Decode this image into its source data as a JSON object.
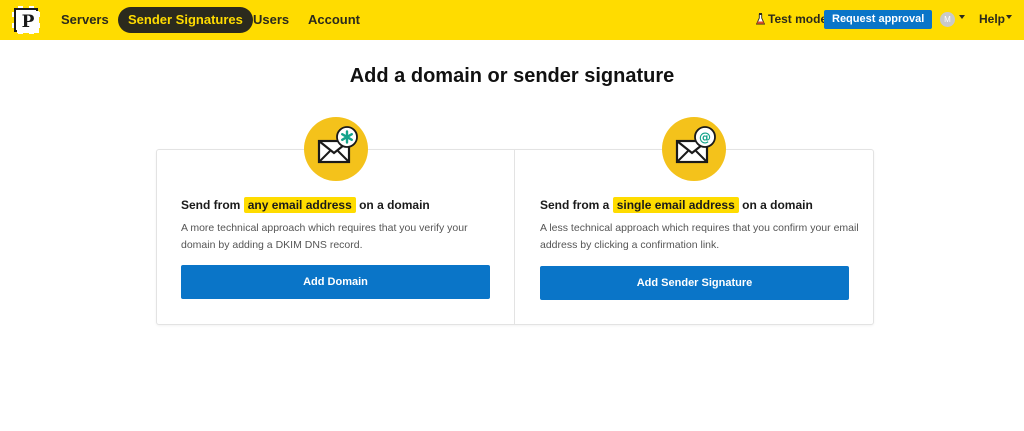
{
  "topbar": {
    "logo_letter": "P",
    "nav": {
      "servers": "Servers",
      "sender_signatures": "Sender Signatures",
      "users": "Users",
      "account": "Account"
    },
    "test_mode": "Test mode",
    "request_approval": "Request approval",
    "avatar_initial": "M",
    "help": "Help"
  },
  "page": {
    "title": "Add a domain or sender signature"
  },
  "options": {
    "domain": {
      "heading_pre": "Send from",
      "heading_highlight": "any email address",
      "heading_post": "on a domain",
      "description": "A more technical approach which requires that you verify your domain by adding a DKIM DNS record.",
      "button": "Add Domain",
      "icon": "envelope-asterisk-icon"
    },
    "signature": {
      "heading_pre": "Send from a",
      "heading_highlight": "single email address",
      "heading_post": "on a domain",
      "description": "A less technical approach which requires that you confirm your email address by clicking a confirmation link.",
      "button": "Add Sender Signature",
      "icon": "envelope-at-icon"
    }
  },
  "colors": {
    "brand_yellow": "#ffdc00",
    "icon_circle": "#f4c21b",
    "primary_blue": "#0a75c8",
    "nav_dark": "#2b2a1d",
    "badge_teal": "#14a38b"
  }
}
